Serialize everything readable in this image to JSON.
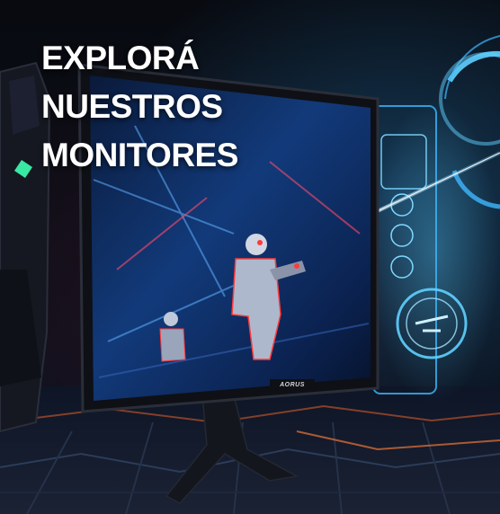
{
  "headline": {
    "line1": "EXPLORÁ",
    "line2": "NUESTROS",
    "line3": "MONITORES"
  },
  "monitor": {
    "brand_label": "AORUS"
  },
  "colors": {
    "text": "#ffffff",
    "hud_accent": "#3fb8ff",
    "laser": "#9fe4ff",
    "robot_red": "#ff3b3b",
    "floor_glow": "#c8552a"
  }
}
